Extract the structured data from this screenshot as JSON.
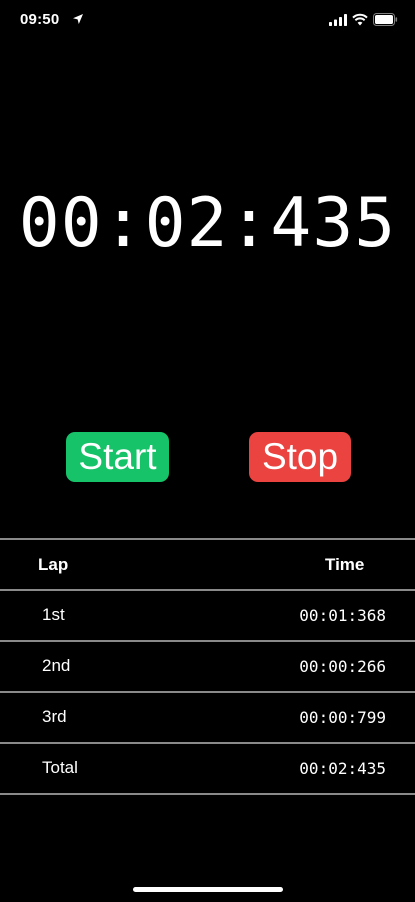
{
  "status_bar": {
    "time": "09:50",
    "icons": [
      "location-arrow-icon",
      "cellular-signal-icon",
      "wifi-icon",
      "battery-icon"
    ]
  },
  "timer": {
    "display": "00:02:435"
  },
  "controls": {
    "start_label": "Start",
    "stop_label": "Stop",
    "start_color": "#17c369",
    "stop_color": "#eb4340"
  },
  "laps": {
    "headers": {
      "lap": "Lap",
      "time": "Time"
    },
    "rows": [
      {
        "name": "1st",
        "time": "00:01:368"
      },
      {
        "name": "2nd",
        "time": "00:00:266"
      },
      {
        "name": "3rd",
        "time": "00:00:799"
      },
      {
        "name": "Total",
        "time": "00:02:435"
      }
    ]
  }
}
